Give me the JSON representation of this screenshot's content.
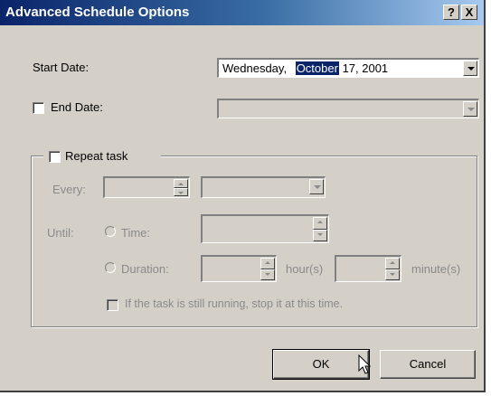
{
  "window": {
    "title": "Advanced Schedule Options",
    "help_glyph": "?",
    "close_glyph": "X"
  },
  "start_date": {
    "label": "Start Date:",
    "weekday": "Wednesday,",
    "month": "October",
    "rest": "17, 2001"
  },
  "end_date": {
    "label": "End Date:"
  },
  "repeat": {
    "label": "Repeat task",
    "every_label": "Every:",
    "until_label": "Until:",
    "time_label": "Time:",
    "duration_label": "Duration:",
    "hours_label": "hour(s)",
    "minutes_label": "minute(s)",
    "stop_label": "If the task is still running, stop it at this time."
  },
  "buttons": {
    "ok": "OK",
    "cancel": "Cancel"
  },
  "colors": {
    "title_gradient_start": "#0a246a",
    "face": "#d4d0c8",
    "disabled_text": "#8a8a8a"
  }
}
